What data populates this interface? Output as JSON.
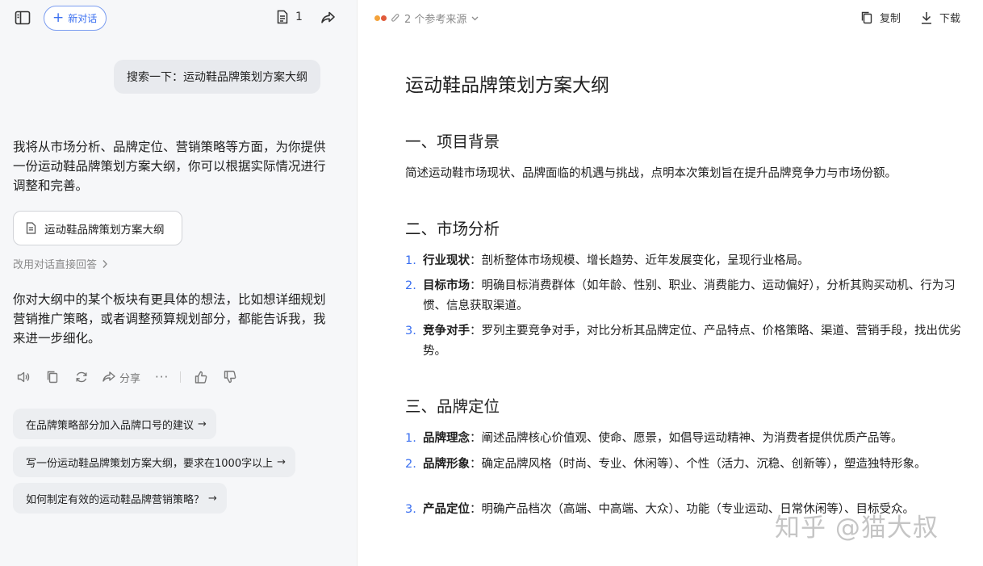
{
  "sidebar_top": {
    "new_chat_label": "新对话",
    "doc_count": "1"
  },
  "chat": {
    "user_query": "搜索一下：运动鞋品牌策划方案大纲",
    "ai_intro": "我将从市场分析、品牌定位、营销策略等方面，为你提供一份运动鞋品牌策划方案大纲，你可以根据实际情况进行调整和完善。",
    "doc_card_title": "运动鞋品牌策划方案大纲",
    "switch_label": "改用对话直接回答",
    "ai_followup": "你对大纲中的某个板块有更具体的想法，比如想详细规划营销推广策略，或者调整预算规划部分，都能告诉我，我来进一步细化。",
    "share_label": "分享",
    "suggestions": [
      "在品牌策略部分加入品牌口号的建议",
      "写一份运动鞋品牌策划方案大纲，要求在1000字以上",
      "如何制定有效的运动鞋品牌营销策略？"
    ]
  },
  "doc_toolbar": {
    "sources_label": "2 个参考来源",
    "copy_label": "复制",
    "download_label": "下载"
  },
  "document": {
    "title": "运动鞋品牌策划方案大纲",
    "section1": {
      "heading": "一、项目背景",
      "text": "简述运动鞋市场现状、品牌面临的机遇与挑战，点明本次策划旨在提升品牌竞争力与市场份额。"
    },
    "section2": {
      "heading": "二、市场分析",
      "items": [
        {
          "num": "1.",
          "term": "行业现状",
          "text": "：剖析整体市场规模、增长趋势、近年发展变化，呈现行业格局。"
        },
        {
          "num": "2.",
          "term": "目标市场",
          "text": "：明确目标消费群体（如年龄、性别、职业、消费能力、运动偏好），分析其购买动机、行为习惯、信息获取渠道。"
        },
        {
          "num": "3.",
          "term": "竞争对手",
          "text": "：罗列主要竞争对手，对比分析其品牌定位、产品特点、价格策略、渠道、营销手段，找出优劣势。"
        }
      ]
    },
    "section3": {
      "heading": "三、品牌定位",
      "items": [
        {
          "num": "1.",
          "term": "品牌理念",
          "text": "：阐述品牌核心价值观、使命、愿景，如倡导运动精神、为消费者提供优质产品等。"
        },
        {
          "num": "2.",
          "term": "品牌形象",
          "text": "：确定品牌风格（时尚、专业、休闲等）、个性（活力、沉稳、创新等），塑造独特形象。"
        },
        {
          "num": "3.",
          "term": "产品定位",
          "text": "：明确产品档次（高端、中高端、大众）、功能（专业运动、日常休闲等）、目标受众。"
        }
      ]
    }
  },
  "watermark": "知乎 @猫大叔"
}
